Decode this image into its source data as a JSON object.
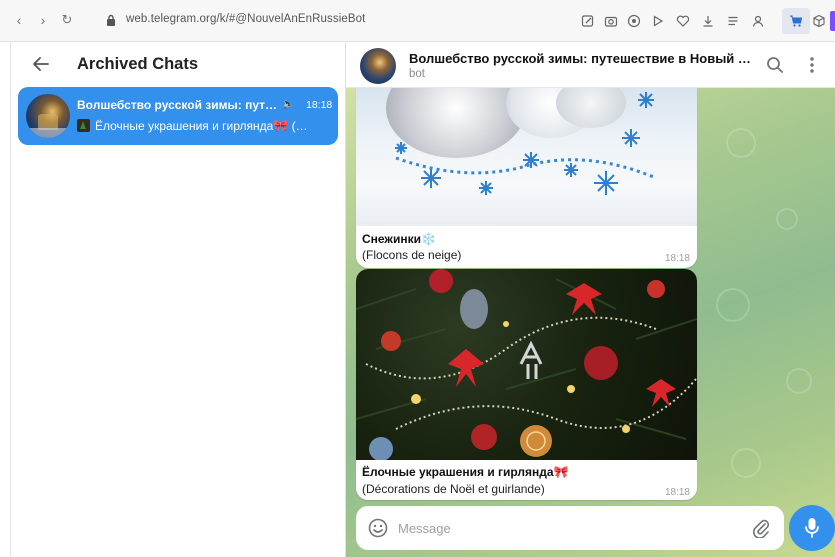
{
  "browser": {
    "url": "web.telegram.org/k/#@NouvelAnEnRussieBot",
    "icons": [
      "back-icon",
      "forward-icon",
      "reload-icon",
      "lock-icon",
      "edit-icon",
      "camera-icon",
      "shield-icon",
      "play-icon",
      "heart-icon",
      "download-icon",
      "list-icon",
      "profile-icon",
      "cart-icon",
      "cube-icon"
    ]
  },
  "left_panel": {
    "title": "Archived Chats",
    "chats": [
      {
        "title": "Волшебство русской зимы: пут…",
        "time": "18:18",
        "preview": "Ёлочные украшения и гирлянда🎀 (…",
        "muted": true,
        "selected": true
      }
    ]
  },
  "chat_header": {
    "title": "Волшебство русской зимы: путешествие в Новый …",
    "status": "bot"
  },
  "messages": [
    {
      "title": "Снежинки❄️",
      "subtitle": "(Flocons de neige)",
      "time": "18:18"
    },
    {
      "title": "Ёлочные украшения и гирлянда🎀",
      "subtitle": "(Décorations de Noël et guirlande)",
      "time": "18:18"
    }
  ],
  "composer": {
    "placeholder": "Message"
  },
  "colors": {
    "accent": "#3390ec",
    "chat_bg": "#a8c98f"
  }
}
